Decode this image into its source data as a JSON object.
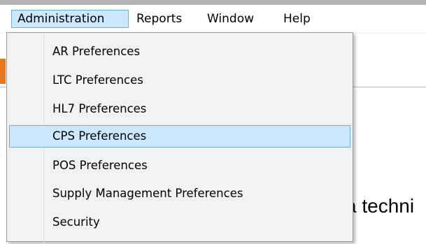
{
  "menubar": {
    "items": [
      {
        "label": "Administration",
        "active": true
      },
      {
        "label": "Reports",
        "active": false
      },
      {
        "label": "Window",
        "active": false
      },
      {
        "label": "Help",
        "active": false
      }
    ]
  },
  "dropdown": {
    "items": [
      {
        "label": "AR Preferences",
        "highlighted": false
      },
      {
        "label": "LTC Preferences",
        "highlighted": false
      },
      {
        "label": "HL7 Preferences",
        "highlighted": false
      },
      {
        "label": "CPS Preferences",
        "highlighted": true
      },
      {
        "label": "POS Preferences",
        "highlighted": false
      },
      {
        "label": "Supply Management Preferences",
        "highlighted": false
      },
      {
        "label": "Security",
        "highlighted": false
      }
    ]
  },
  "background": {
    "partial_text": "a techni"
  },
  "colors": {
    "highlight_bg": "#cce8ff",
    "highlight_border": "#6eaed8",
    "menu_bg": "#f2f2f2",
    "accent_orange": "#e8781e"
  }
}
